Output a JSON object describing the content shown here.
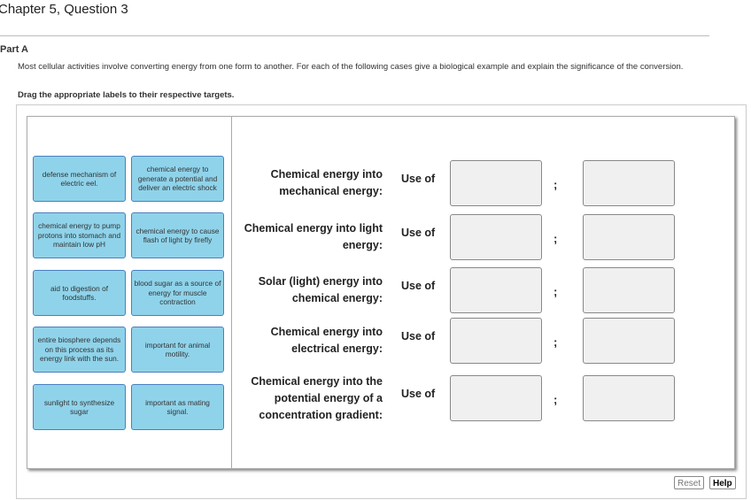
{
  "header": {
    "title": "Chapter 5, Question 3",
    "part": "Part A"
  },
  "instructions": "Most cellular activities involve converting energy from one form to another. For each of the following cases give a biological example and explain the significance of the conversion.",
  "drag_prompt": "Drag the appropriate labels to their respective targets.",
  "labels": [
    "defense mechanism of electric eel.",
    "chemical energy to generate a potential and deliver an electric shock",
    "chemical energy to pump protons into stomach and maintain low pH",
    "chemical energy to cause flash of light by firefly",
    "aid to digestion of foodstuffs.",
    "blood sugar as a source of energy for muscle contraction",
    "entire biosphere depends on this process as its energy link with the sun.",
    "important for animal motility.",
    "sunlight to synthesize sugar",
    "important as mating signal."
  ],
  "targets": [
    {
      "description": "Chemical energy into mechanical energy:",
      "use_of": "Use of",
      "separator": ";"
    },
    {
      "description": "Chemical energy into light energy:",
      "use_of": "Use of",
      "separator": ";"
    },
    {
      "description": "Solar (light) energy into chemical energy:",
      "use_of": "Use of",
      "separator": ";"
    },
    {
      "description": "Chemical energy into electrical energy:",
      "use_of": "Use of",
      "separator": ";"
    },
    {
      "description": "Chemical energy into the potential energy of a concentration gradient:",
      "use_of": "Use of",
      "separator": ";"
    }
  ],
  "buttons": {
    "reset": "Reset",
    "help": "Help"
  }
}
